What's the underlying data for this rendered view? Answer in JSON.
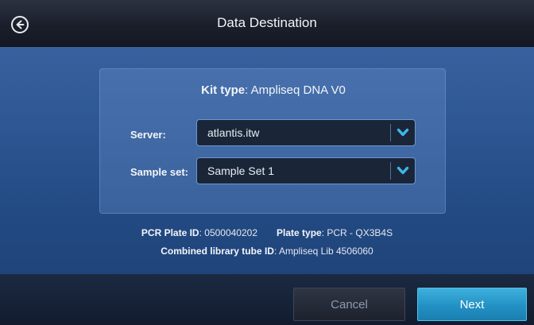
{
  "header": {
    "title": "Data Destination"
  },
  "kit": {
    "label": "Kit type",
    "value": "Ampliseq DNA V0"
  },
  "server": {
    "label": "Server",
    "value": "atlantis.itw"
  },
  "sample_set": {
    "label": "Sample set",
    "value": "Sample Set 1"
  },
  "info": {
    "pcr_plate_id_label": "PCR Plate ID",
    "pcr_plate_id_value": "0500040202",
    "plate_type_label": "Plate type",
    "plate_type_value": "PCR - QX3B4S",
    "combined_tube_label": "Combined library tube ID",
    "combined_tube_value": "Ampliseq Lib 4506060"
  },
  "footer": {
    "cancel_label": "Cancel",
    "next_label": "Next"
  },
  "colors": {
    "accent": "#2a9fd6",
    "dropdown_chevron": "#3fb6ea"
  },
  "icons": {
    "back": "back-arrow-circle-icon",
    "dropdown": "chevron-down-icon"
  }
}
